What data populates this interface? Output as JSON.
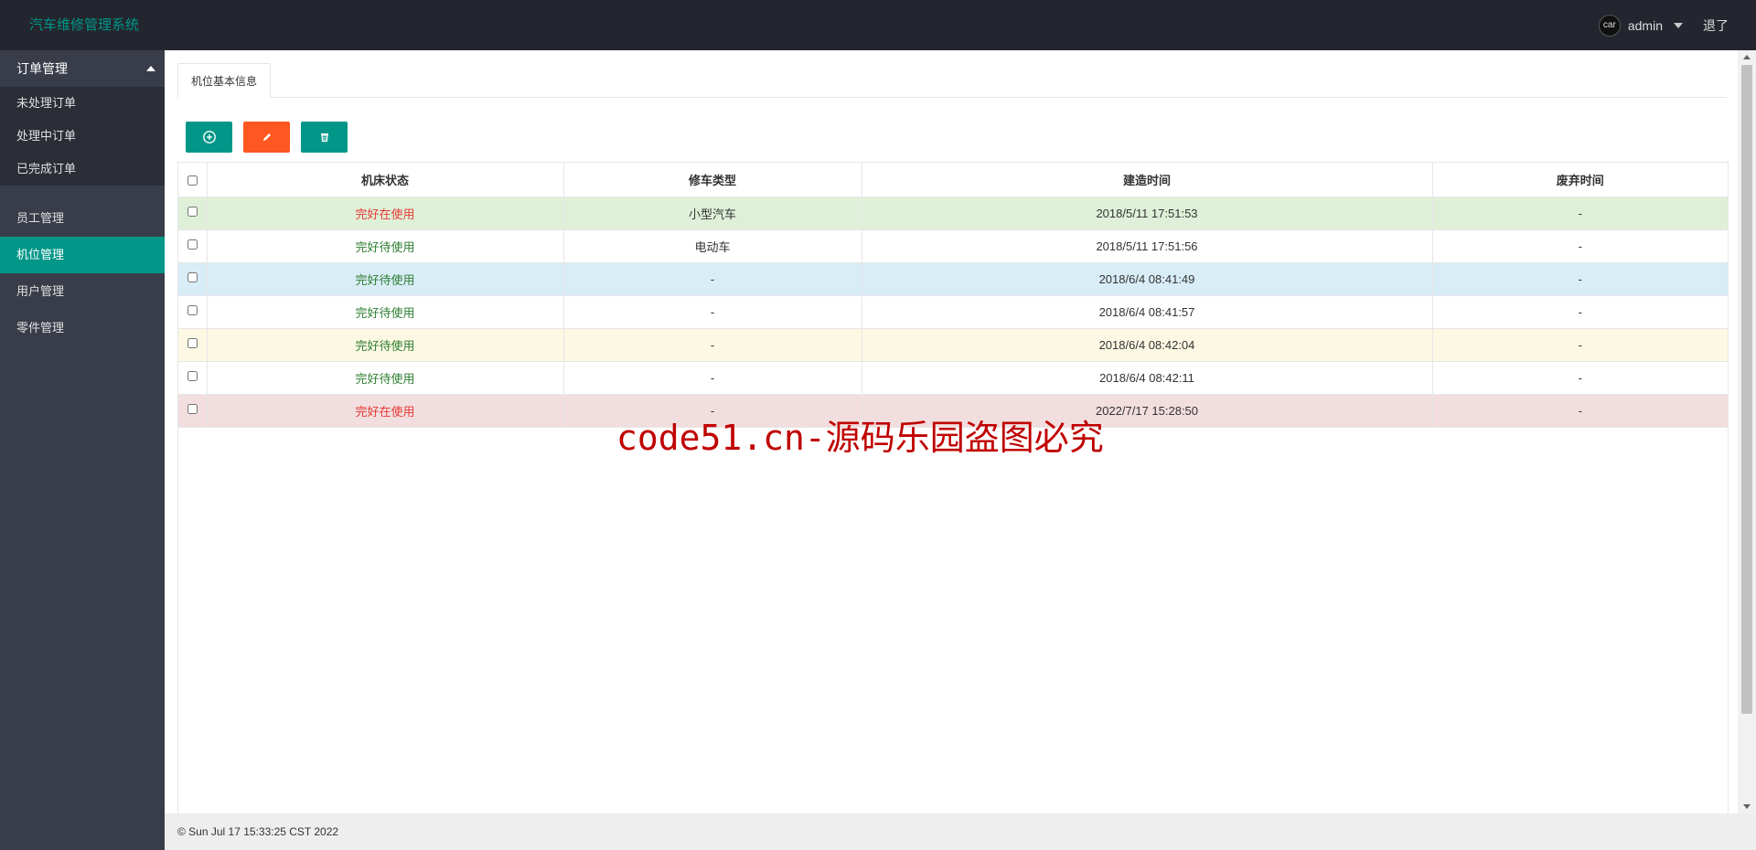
{
  "app": {
    "title": "汽车维修管理系统"
  },
  "header": {
    "user_name": "admin",
    "avatar_text": "car",
    "logout_label": "退了"
  },
  "sidebar": {
    "group": {
      "title": "订单管理",
      "items": [
        {
          "label": "未处理订单"
        },
        {
          "label": "处理中订单"
        },
        {
          "label": "已完成订单"
        }
      ]
    },
    "items": [
      {
        "label": "员工管理",
        "active": false
      },
      {
        "label": "机位管理",
        "active": true
      },
      {
        "label": "用户管理",
        "active": false
      },
      {
        "label": "零件管理",
        "active": false
      }
    ]
  },
  "main": {
    "tab_label": "机位基本信息",
    "toolbar": {
      "add_icon": "plus-circle-icon",
      "edit_icon": "pencil-icon",
      "delete_icon": "trash-icon"
    },
    "table": {
      "columns": [
        "机床状态",
        "修车类型",
        "建造时间",
        "废弃时间"
      ],
      "rows": [
        {
          "status": "完好在使用",
          "type": "小型汽车",
          "built": "2018/5/11 17:51:53",
          "discarded": "-",
          "status_color": "#e53935",
          "row_bg": "#dff0d8"
        },
        {
          "status": "完好待使用",
          "type": "电动车",
          "built": "2018/5/11 17:51:56",
          "discarded": "-",
          "status_color": "#2e7d32",
          "row_bg": "#ffffff"
        },
        {
          "status": "完好待使用",
          "type": "-",
          "built": "2018/6/4 08:41:49",
          "discarded": "-",
          "status_color": "#2e7d32",
          "row_bg": "#d9edf7"
        },
        {
          "status": "完好待使用",
          "type": "-",
          "built": "2018/6/4 08:41:57",
          "discarded": "-",
          "status_color": "#2e7d32",
          "row_bg": "#ffffff"
        },
        {
          "status": "完好待使用",
          "type": "-",
          "built": "2018/6/4 08:42:04",
          "discarded": "-",
          "status_color": "#2e7d32",
          "row_bg": "#fcf8e3"
        },
        {
          "status": "完好待使用",
          "type": "-",
          "built": "2018/6/4 08:42:11",
          "discarded": "-",
          "status_color": "#2e7d32",
          "row_bg": "#ffffff"
        },
        {
          "status": "完好在使用",
          "type": "-",
          "built": "2022/7/17 15:28:50",
          "discarded": "-",
          "status_color": "#e53935",
          "row_bg": "#f2dede"
        }
      ]
    }
  },
  "footer": {
    "text": "© Sun Jul 17 15:33:25 CST 2022"
  },
  "watermark": {
    "text": "code51.cn-源码乐园盗图必究"
  },
  "colors": {
    "header_bg": "#23262e",
    "sidebar_bg": "#393d49",
    "accent": "#009688",
    "orange": "#ff5722"
  }
}
